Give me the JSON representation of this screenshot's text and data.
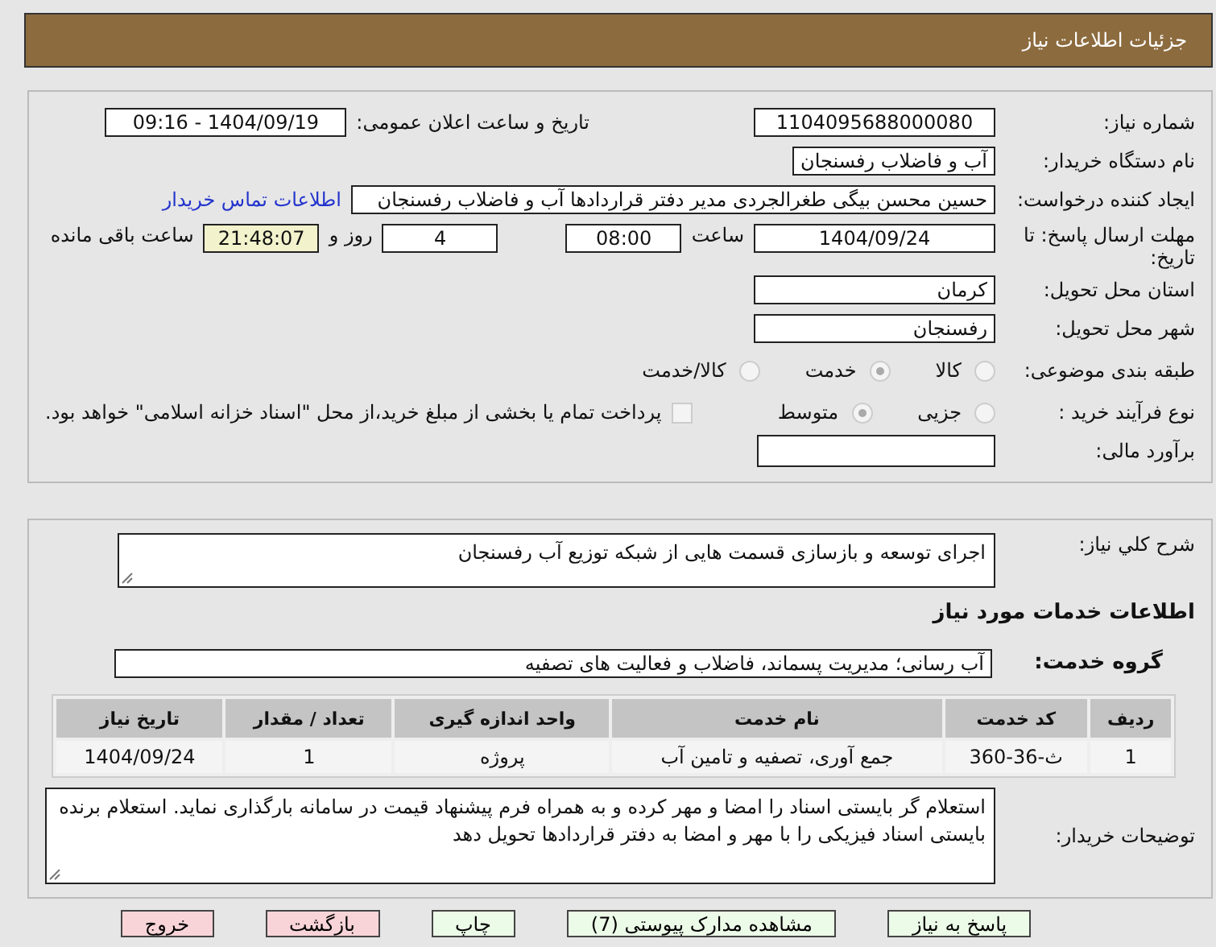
{
  "header": {
    "title": "جزئیات اطلاعات نیاز"
  },
  "need_number": {
    "label": "شماره نیاز:",
    "value": "1104095688000080"
  },
  "announce": {
    "label": "تاریخ و ساعت اعلان عمومی:",
    "value": "1404/09/19 - 09:16"
  },
  "buyer": {
    "label": "نام دستگاه خریدار:",
    "value": "آب و فاضلاب رفسنجان"
  },
  "requester": {
    "label": "ایجاد کننده درخواست:",
    "value": "حسین محسن بیگی طغرالجردی مدیر دفتر قراردادها آب و فاضلاب رفسنجان",
    "link": "اطلاعات تماس خریدار"
  },
  "deadline": {
    "label": "مهلت ارسال پاسخ: تا تاریخ:",
    "date": "1404/09/24",
    "time_label": "ساعت",
    "time": "08:00",
    "days": "4",
    "days_label": "روز و",
    "remaining": "21:48:07",
    "remaining_label": "ساعت باقی مانده"
  },
  "province": {
    "label": "استان محل تحویل:",
    "value": "کرمان"
  },
  "city": {
    "label": "شهر محل تحویل:",
    "value": "رفسنجان"
  },
  "category": {
    "label": "طبقه بندی موضوعی:",
    "options": [
      {
        "label": "کالا",
        "selected": false
      },
      {
        "label": "خدمت",
        "selected": true
      },
      {
        "label": "کالا/خدمت",
        "selected": false
      }
    ]
  },
  "purchase_type": {
    "label": "نوع فرآیند خرید :",
    "options": [
      {
        "label": "جزیی",
        "selected": false
      },
      {
        "label": "متوسط",
        "selected": true
      }
    ],
    "payment": {
      "checked": false,
      "text": "پرداخت تمام یا بخشی از مبلغ خرید،از محل \"اسناد خزانه اسلامی\" خواهد بود."
    }
  },
  "budget": {
    "label": "برآورد مالی:"
  },
  "description": {
    "label": "شرح کلي نياز:",
    "value": "اجرای توسعه و بازسازی قسمت هایی از شبکه توزیع آب رفسنجان"
  },
  "services_title": "اطلاعات خدمات مورد نياز",
  "service_group": {
    "label": "گروه خدمت:",
    "value": "آب رسانی؛ مدیریت پسماند، فاضلاب و فعالیت های تصفیه"
  },
  "table": {
    "columns": [
      "ردیف",
      "کد خدمت",
      "نام خدمت",
      "واحد اندازه گیری",
      "تعداد / مقدار",
      "تاریخ نیاز"
    ],
    "rows": [
      [
        "1",
        "ث-36-360",
        "جمع آوری، تصفیه و تامین آب",
        "پروژه",
        "1",
        "1404/09/24"
      ]
    ]
  },
  "buyer_notes": {
    "label": "توضیحات خریدار:",
    "value": "استعلام گر بایستی اسناد را امضا و مهر کرده و به همراه فرم پیشنهاد قیمت در سامانه بارگذاری نماید. استعلام برنده بایستی اسناد فیزیکی را با مهر و امضا به دفتر قراردادها تحویل دهد"
  },
  "buttons": [
    {
      "label": "پاسخ به نیاز",
      "kind": "action"
    },
    {
      "label": "مشاهده مدارک پیوستی (7)",
      "kind": "action"
    },
    {
      "label": "چاپ",
      "kind": "action"
    },
    {
      "label": "بازگشت",
      "kind": "leave"
    },
    {
      "label": "خروج",
      "kind": "leave"
    }
  ]
}
